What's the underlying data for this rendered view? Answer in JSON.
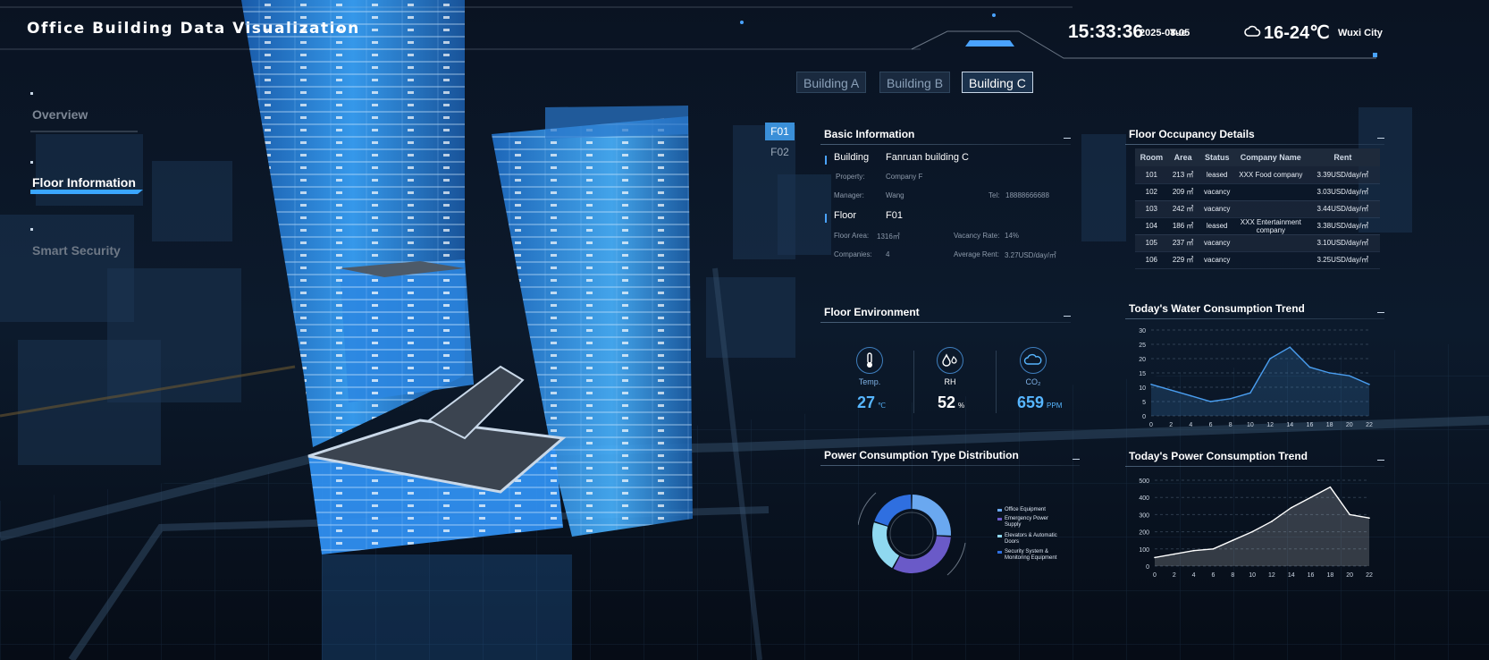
{
  "header": {
    "app_title": "Office Building Data Visualization",
    "clock": "15:33:36",
    "date": "2025-08-05",
    "weekday": "Tue",
    "weather_icon": "cloud-sun-icon",
    "temp_range": "16-24℃",
    "city": "Wuxi City"
  },
  "building_tabs": [
    {
      "label": "Building A",
      "active": false
    },
    {
      "label": "Building B",
      "active": false
    },
    {
      "label": "Building C",
      "active": true
    }
  ],
  "nav": [
    {
      "label": "Overview",
      "active": false
    },
    {
      "label": "Floor Information",
      "active": true
    },
    {
      "label": "Smart Security",
      "active": false
    }
  ],
  "floors": [
    {
      "label": "F01",
      "active": true
    },
    {
      "label": "F02",
      "active": false
    }
  ],
  "basic_info": {
    "title": "Basic Information",
    "building_label": "Building",
    "building_value": "Fanruan building C",
    "property_label": "Property:",
    "property_value": "Company F",
    "manager_label": "Manager:",
    "manager_value": "Wang",
    "tel_label": "Tel:",
    "tel_value": "18888666688",
    "floor_label": "Floor",
    "floor_value": "F01",
    "floor_area_label": "Floor Area:",
    "floor_area_value": "1316㎡",
    "vacancy_rate_label": "Vacancy Rate:",
    "vacancy_rate_value": "14%",
    "companies_label": "Companies:",
    "companies_value": "4",
    "avg_rent_label": "Average Rent:",
    "avg_rent_value": "3.27USD/day/㎡"
  },
  "occupancy": {
    "title": "Floor Occupancy Details",
    "columns": [
      "Room",
      "Area",
      "Status",
      "Company Name",
      "Rent"
    ],
    "rows": [
      [
        "101",
        "213 ㎡",
        "leased",
        "XXX Food company",
        "3.39USD/day/㎡"
      ],
      [
        "102",
        "209 ㎡",
        "vacancy",
        "",
        "3.03USD/day/㎡"
      ],
      [
        "103",
        "242 ㎡",
        "vacancy",
        "",
        "3.44USD/day/㎡"
      ],
      [
        "104",
        "186 ㎡",
        "leased",
        "XXX Entertainment company",
        "3.38USD/day/㎡"
      ],
      [
        "105",
        "237 ㎡",
        "vacancy",
        "",
        "3.10USD/day/㎡"
      ],
      [
        "106",
        "229 ㎡",
        "vacancy",
        "",
        "3.25USD/day/㎡"
      ]
    ]
  },
  "environment": {
    "title": "Floor Environment",
    "temp_label": "Temp.",
    "temp_value": "27",
    "temp_unit": "℃",
    "rh_label": "RH",
    "rh_value": "52",
    "rh_unit": "%",
    "co2_label": "CO₂",
    "co2_value": "659",
    "co2_unit": "PPM",
    "temp_icon": "thermometer-icon",
    "rh_icon": "humidity-icon",
    "co2_icon": "cloud-co2-icon"
  },
  "power_distribution": {
    "title": "Power Consumption Type Distribution"
  },
  "water_trend": {
    "title": "Today's Water Consumption Trend"
  },
  "power_trend": {
    "title": "Today's Power Consumption Trend"
  },
  "chart_data": [
    {
      "type": "pie",
      "labels": [
        "Office Equipment",
        "Emergency Power Supply",
        "Elevators & Automatic Doors",
        "Security System & Monitoring Equipment"
      ],
      "values": [
        26,
        32,
        22,
        20
      ],
      "colors": [
        "#6aa8f0",
        "#6a5ac8",
        "#8fd8f0",
        "#2f6fe0"
      ]
    },
    {
      "type": "area",
      "x": [
        0,
        2,
        4,
        6,
        8,
        10,
        12,
        14,
        16,
        18,
        20,
        22
      ],
      "values": [
        11,
        9,
        7,
        5,
        6,
        8,
        20,
        24,
        17,
        15,
        14,
        11
      ],
      "xlim": [
        0,
        22
      ],
      "ylim": [
        0,
        30
      ],
      "yticks": [
        0,
        5,
        10,
        15,
        20,
        25,
        30
      ],
      "xticks": [
        0,
        2,
        4,
        6,
        8,
        10,
        12,
        14,
        16,
        18,
        20,
        22
      ],
      "color": "#4a9ef0"
    },
    {
      "type": "area",
      "x": [
        0,
        2,
        4,
        6,
        8,
        10,
        12,
        14,
        16,
        18,
        20,
        22
      ],
      "values": [
        50,
        70,
        90,
        100,
        150,
        200,
        260,
        340,
        400,
        460,
        300,
        280
      ],
      "xlim": [
        0,
        22
      ],
      "ylim": [
        0,
        500
      ],
      "yticks": [
        0,
        100,
        200,
        300,
        400,
        500
      ],
      "xticks": [
        0,
        2,
        4,
        6,
        8,
        10,
        12,
        14,
        16,
        18,
        20,
        22
      ],
      "color": "#ffffff"
    }
  ]
}
